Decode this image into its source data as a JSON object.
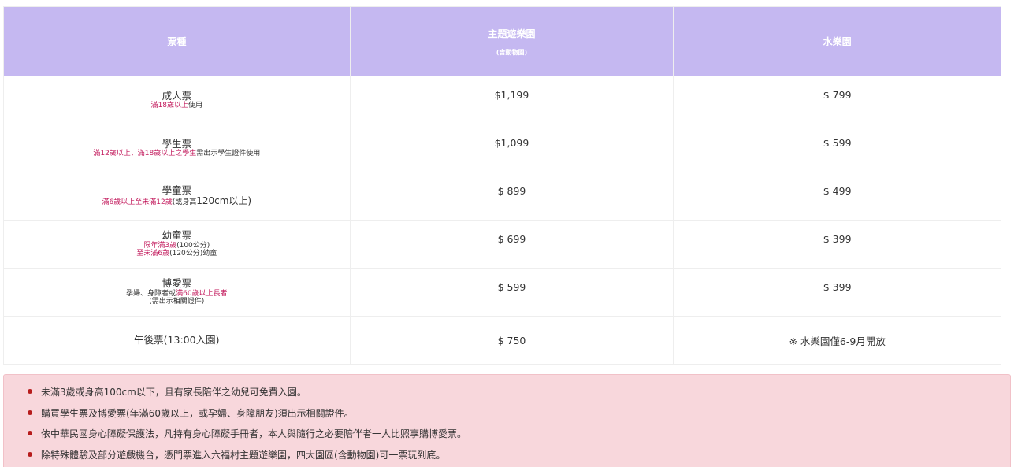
{
  "header": {
    "col_type": "票種",
    "col_theme": "主題遊樂園",
    "col_theme_sub": "(含動物園)",
    "col_water": "水樂園"
  },
  "rows": [
    {
      "name": "成人票",
      "notes": [
        [
          {
            "t": "滿18歲以上",
            "hl": true
          },
          {
            "t": "使用",
            "hl": false
          }
        ]
      ],
      "theme": "$1,199",
      "water": "$ 799"
    },
    {
      "name": "學生票",
      "notes": [
        [
          {
            "t": "滿12歲以上，滿18歲以上之學生",
            "hl": true
          },
          {
            "t": "需出示學生證件使用",
            "hl": false
          }
        ]
      ],
      "theme": "$1,099",
      "water": "$ 599"
    },
    {
      "name": "學童票",
      "notes": [
        [
          {
            "t": "滿6歲以上至未滿12歲",
            "hl": true
          },
          {
            "t": "(或身高",
            "hl": false
          },
          {
            "t": "120cm以上)",
            "hl": false,
            "big": true
          }
        ]
      ],
      "theme": "$ 899",
      "water": "$ 499"
    },
    {
      "name": "幼童票",
      "notes": [
        [
          {
            "t": "限年滿3歲",
            "hl": true
          },
          {
            "t": "(100公分)",
            "hl": false
          }
        ],
        [
          {
            "t": "至未滿6歲",
            "hl": true
          },
          {
            "t": "(120公分)幼童",
            "hl": false
          }
        ]
      ],
      "theme": "$ 699",
      "water": "$ 399"
    },
    {
      "name": "博愛票",
      "notes": [
        [
          {
            "t": "孕婦、身障者或",
            "hl": false
          },
          {
            "t": "滿60歲以上長者",
            "hl": true
          }
        ],
        [
          {
            "t": "(需出示相關證件)",
            "hl": false
          }
        ]
      ],
      "theme": "$ 599",
      "water": "$ 399"
    },
    {
      "name": "午後票(13:00入園)",
      "notes": [],
      "theme": "$ 750",
      "water": "※ 水樂園僅6-9月開放"
    }
  ],
  "notes": [
    "未滿3歲或身高100cm以下，且有家長陪伴之幼兒可免費入園。",
    "購買學生票及博愛票(年滿60歲以上，或孕婦、身障朋友)須出示相關證件。",
    "依中華民國身心障礙保護法，凡持有身心障礙手冊者，本人與隨行之必要陪伴者一人比照享購博愛票。",
    "除特殊體驗及部分遊戲機台，憑門票進入六福村主題遊樂園，四大園區(含動物園)可一票玩到底。"
  ],
  "colors": {
    "header_bg": "#c5b8f1",
    "highlight": "#c2185b",
    "notes_bg": "#f8d7dc",
    "bullet": "#b71c1c"
  }
}
